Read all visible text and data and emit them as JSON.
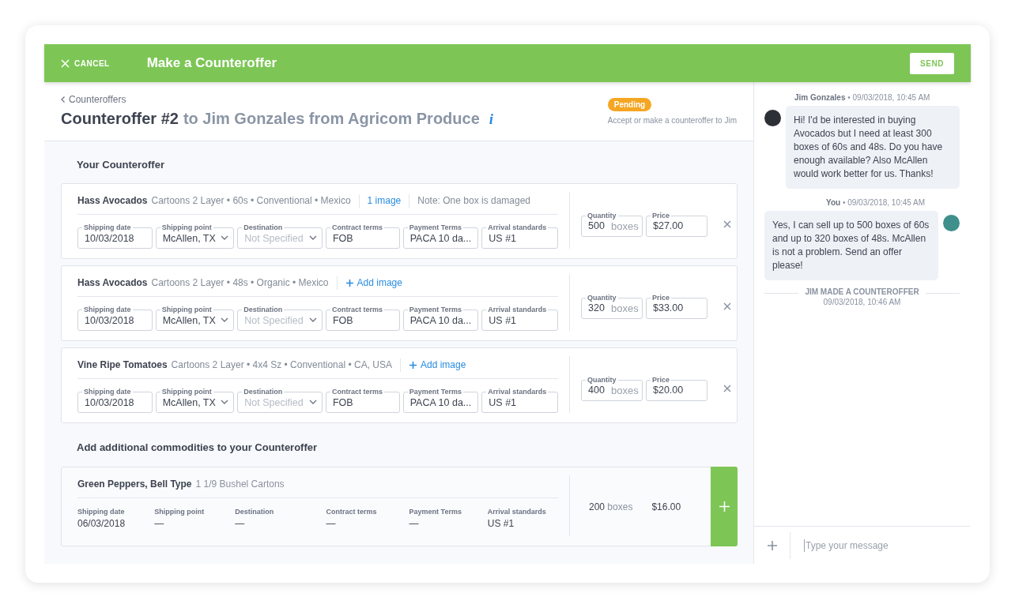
{
  "header": {
    "cancel": "CANCEL",
    "title": "Make a Counteroffer",
    "send": "SEND"
  },
  "offer": {
    "breadcrumb": "Counteroffers",
    "title": "Counteroffer #2",
    "subtitle": "to Jim Gonzales from Agricom Produce",
    "info": "i",
    "status": {
      "label": "Pending",
      "color": "#f5a623"
    },
    "hint": "Accept or make a counteroffer to Jim"
  },
  "section_title": "Your Counteroffer",
  "items": [
    {
      "product": "Hass Avocados",
      "details": "Cartoons 2 Layer • 60s • Conventional • Mexico",
      "attachment": {
        "kind": "link",
        "label": "1 image"
      },
      "note": "Note: One box is damaged",
      "fields": [
        {
          "label": "Shipping date",
          "kind": "text",
          "value": "10/03/2018"
        },
        {
          "label": "Shipping point",
          "kind": "select",
          "value": "McAllen, TX"
        },
        {
          "label": "Destination",
          "kind": "select",
          "placeholder": "Not Specified"
        },
        {
          "label": "Contract terms",
          "kind": "text",
          "value": "FOB"
        },
        {
          "label": "Payment Terms",
          "kind": "text",
          "value": "PACA 10 da..."
        },
        {
          "label": "Arrival standards",
          "kind": "text",
          "value": "US #1"
        }
      ],
      "quantity_label": "Quantity",
      "quantity": "500",
      "unit": "boxes",
      "price_label": "Price",
      "price": "$27.00"
    },
    {
      "product": "Hass Avocados",
      "details": "Cartoons 2 Layer • 48s • Organic • Mexico",
      "attachment": {
        "kind": "add",
        "label": "Add image"
      },
      "fields": [
        {
          "label": "Shipping date",
          "kind": "text",
          "value": "10/03/2018"
        },
        {
          "label": "Shipping point",
          "kind": "select",
          "value": "McAllen, TX"
        },
        {
          "label": "Destination",
          "kind": "select",
          "placeholder": "Not Specified"
        },
        {
          "label": "Contract terms",
          "kind": "text",
          "value": "FOB"
        },
        {
          "label": "Payment Terms",
          "kind": "text",
          "value": "PACA 10 da..."
        },
        {
          "label": "Arrival standards",
          "kind": "text",
          "value": "US #1"
        }
      ],
      "quantity_label": "Quantity",
      "quantity": "320",
      "unit": "boxes",
      "price_label": "Price",
      "price": "$33.00"
    },
    {
      "product": "Vine Ripe Tomatoes",
      "details": "Cartoons 2 Layer • 4x4 Sz • Conventional • CA, USA",
      "attachment": {
        "kind": "add",
        "label": "Add image"
      },
      "fields": [
        {
          "label": "Shipping date",
          "kind": "text",
          "value": "10/03/2018"
        },
        {
          "label": "Shipping point",
          "kind": "select",
          "value": "McAllen, TX"
        },
        {
          "label": "Destination",
          "kind": "select",
          "placeholder": "Not Specified"
        },
        {
          "label": "Contract terms",
          "kind": "text",
          "value": "FOB"
        },
        {
          "label": "Payment Terms",
          "kind": "text",
          "value": "PACA 10 da..."
        },
        {
          "label": "Arrival standards",
          "kind": "text",
          "value": "US #1"
        }
      ],
      "quantity_label": "Quantity",
      "quantity": "400",
      "unit": "boxes",
      "price_label": "Price",
      "price": "$20.00"
    }
  ],
  "additional": {
    "title": "Add additional commodities to your Counteroffer",
    "items": [
      {
        "product": "Green Peppers, Bell Type",
        "details": "1 1/9 Bushel Cartons",
        "fields": [
          {
            "label": "Shipping date",
            "value": "06/03/2018"
          },
          {
            "label": "Shipping point",
            "value": "—"
          },
          {
            "label": "Destination",
            "value": "—"
          },
          {
            "label": "Contract terms",
            "value": "—"
          },
          {
            "label": "Payment Terms",
            "value": "—"
          },
          {
            "label": "Arrival standards",
            "value": "US #1"
          }
        ],
        "quantity": "200",
        "unit": "boxes",
        "price": "$16.00"
      }
    ]
  },
  "chat": {
    "messages": [
      {
        "kind": "incoming",
        "sender": "Jim Gonzales",
        "time": "• 09/03/2018, 10:45 AM",
        "text": "Hi! I'd be interested in buying Avocados but I need at least 300 boxes of 60s and 48s. Do you have enough available? Also McAllen would work better for us. Thanks!"
      },
      {
        "kind": "outgoing",
        "sender": "You",
        "time": "• 09/03/2018, 10:45 AM",
        "text": "Yes, I can sell up to 500 boxes of 60s and up to 320 boxes of 48s. McAllen is not a problem. Send an offer please!"
      }
    ],
    "event": {
      "title": "JIM MADE A COUNTEROFFER",
      "time": "09/03/2018, 10:46 AM"
    },
    "composer": {
      "placeholder": "Type your message"
    }
  }
}
